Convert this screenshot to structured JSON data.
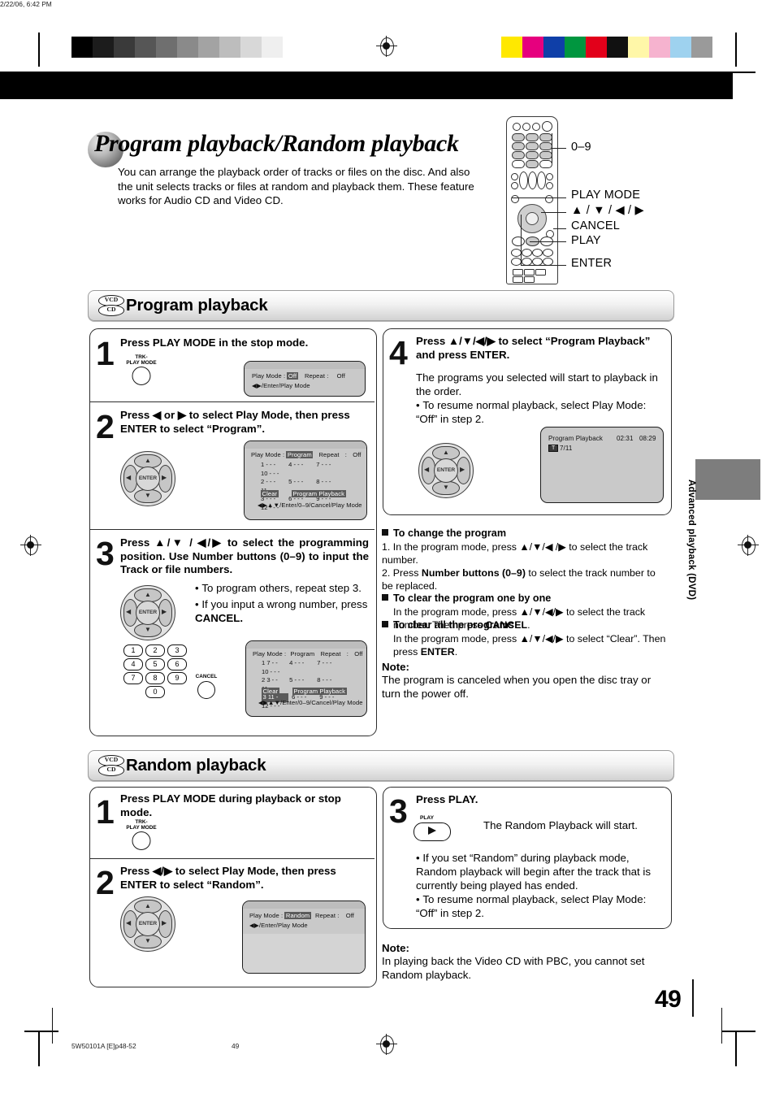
{
  "document": {
    "page_title": "Program playback/Random playback",
    "intro": "You can arrange the playback order of tracks or files on the disc. And also the unit selects tracks or files at random and playback them. These feature works for Audio CD and Video CD.",
    "page_number": "49",
    "side_tab_label": "Advanced playback (DVD)"
  },
  "remote_callouts": [
    {
      "label": "0–9"
    },
    {
      "label": "PLAY MODE"
    },
    {
      "label": "▲ / ▼ / ◀ / ▶"
    },
    {
      "label": "CANCEL"
    },
    {
      "label": "PLAY"
    },
    {
      "label": "ENTER"
    }
  ],
  "disc_icons": {
    "top": "VCD",
    "bottom": "CD"
  },
  "sections": [
    {
      "id": "program",
      "title": "Program playback",
      "steps": [
        {
          "num": "1",
          "text": "Press PLAY MODE in the stop mode.",
          "button": {
            "label_top": "TRK-",
            "label_bottom": "PLAY MODE"
          },
          "osd": {
            "line1_pre": "Play Mode  :",
            "line1_value": "Off",
            "line1_mid": "Repeat  :",
            "line1_end": "Off",
            "line2": "◀▶/Enter/Play Mode"
          }
        },
        {
          "num": "2",
          "text": "Press ◀ or ▶ to select Play Mode, then press ENTER to select “Program”.",
          "osd": {
            "line1_pre": "Play Mode  :",
            "line1_value": "Program",
            "line1_mid": "Repeat",
            "line1_colon": ":",
            "line1_end": "Off",
            "rows": [
              [
                "1  - - -",
                "4  - - -",
                "7  - - -",
                "10  - - -"
              ],
              [
                "2  - - -",
                "5  - - -",
                "8  - - -",
                "11  - - -"
              ],
              [
                "3  - - -",
                "6  - - -",
                "9  - - -",
                "12  - - -"
              ]
            ],
            "clear": "Clear",
            "program_playback": "Program Playback",
            "footer": "◀▶▲▼/Enter/0–9/Cancel/Play Mode"
          }
        },
        {
          "num": "3",
          "text": "Press ▲/▼ / ◀/▶  to select the programming position. Use Number buttons (0–9) to input the Track or file numbers.",
          "bullets": [
            "To program others, repeat step 3.",
            "If you input a wrong number, press CANCEL."
          ],
          "numpad": [
            "1",
            "2",
            "3",
            "4",
            "5",
            "6",
            "7",
            "8",
            "9",
            "0"
          ],
          "cancel_label": "CANCEL",
          "osd": {
            "line1_pre": "Play Mode  :",
            "line1_value": "Program",
            "line1_mid": "Repeat",
            "line1_colon": ":",
            "line1_end": "Off",
            "rows": [
              [
                "1  7 - -",
                "4  - - -",
                "7  - - -",
                "10  - - -"
              ],
              [
                "2  3 - -",
                "5  - - -",
                "8  - - -",
                "11  - - -"
              ],
              [
                "3  11 -",
                "6  - - -",
                "9  - - -",
                "12  - - -"
              ]
            ],
            "highlight_cell": "3  11 -",
            "clear": "Clear",
            "program_playback": "Program Playback",
            "footer": "◀▶▲▼/Enter/0–9/Cancel/Play Mode"
          }
        },
        {
          "num": "4",
          "text": "Press ▲/▼/◀/▶ to select “Program Playback” and press ENTER.",
          "body": "The programs you selected will start to playback in the order.",
          "bullets": [
            "To resume normal playback, select Play Mode: “Off” in step 2."
          ],
          "osd": {
            "title": "Program Playback",
            "time1": "02:31",
            "time2": "08:29",
            "track_icon": "T",
            "track": "7/11"
          }
        }
      ],
      "notes": [
        {
          "heading": "To change the program",
          "items": [
            "1. In the program mode, press ▲/▼/◀ /▶ to select the track number.",
            "2. Press Number buttons (0–9) to select the track number to be replaced."
          ]
        },
        {
          "heading": "To clear the program one by one",
          "items": [
            "In the program mode, press ▲/▼/◀/▶ to select the track number. Then press CANCEL."
          ]
        },
        {
          "heading": "To clear all the programs",
          "items": [
            "In the program mode, press ▲/▼/◀/▶ to select “Clear”. Then press ENTER."
          ]
        }
      ],
      "note": {
        "label": "Note:",
        "text": "The program is canceled when you open the disc tray or turn the power off."
      }
    },
    {
      "id": "random",
      "title": "Random playback",
      "steps": [
        {
          "num": "1",
          "text": "Press PLAY MODE during playback or stop mode.",
          "button": {
            "label_top": "TRK-",
            "label_bottom": "PLAY MODE"
          }
        },
        {
          "num": "2",
          "text": "Press ◀/▶ to select Play Mode, then press ENTER to select “Random”.",
          "osd": {
            "line1_pre": "Play Mode  :",
            "line1_value": "Random",
            "line1_mid": "Repeat  :",
            "line1_end": "Off",
            "line2": "◀▶/Enter/Play Mode"
          }
        },
        {
          "num": "3",
          "text": "Press PLAY.",
          "play_label": "PLAY",
          "body": "The Random Playback will start.",
          "bullets": [
            "If you set “Random” during playback mode, Random playback will begin after the track that is currently being played has ended.",
            "To resume normal playback, select Play Mode: “Off” in step 2."
          ]
        }
      ],
      "note": {
        "label": "Note:",
        "text": "In playing back the Video CD with PBC, you cannot set Random playback."
      }
    }
  ],
  "enter_label": "ENTER",
  "footer": {
    "left": "5W50101A [E]p48-52",
    "center": "49",
    "right": "2/22/06, 6:42 PM"
  },
  "colors": {
    "osd_bg": "#c9c9c9",
    "highlight": "#5a5a5a",
    "side_tab": "#7d7d7d",
    "ink": "#000000"
  }
}
